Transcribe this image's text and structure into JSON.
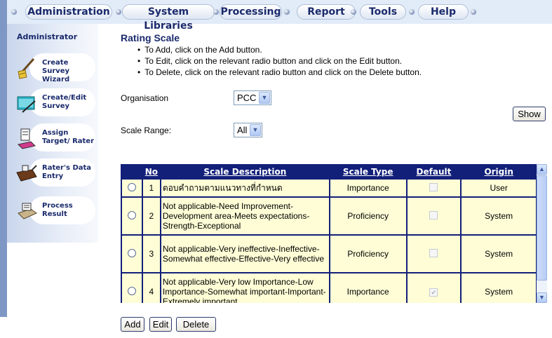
{
  "menu": {
    "tabs": [
      {
        "label": "Administration"
      },
      {
        "label": "System Libraries"
      },
      {
        "label": "Processing"
      },
      {
        "label": "Report"
      },
      {
        "label": "Tools"
      },
      {
        "label": "Help"
      }
    ]
  },
  "sidebar": {
    "title": "Administrator",
    "items": [
      {
        "label": "Create Survey Wizard",
        "icon": "wizard-broom-icon"
      },
      {
        "label": "Create/Edit Survey",
        "icon": "folder-edit-icon"
      },
      {
        "label": "Assign Target/ Rater",
        "icon": "assign-target-icon"
      },
      {
        "label": "Rater's Data Entry",
        "icon": "data-entry-icon"
      },
      {
        "label": "Process Result",
        "icon": "process-result-icon"
      }
    ]
  },
  "main": {
    "title": "Rating Scale",
    "instructions": [
      "To Add, click on the Add button.",
      "To Edit, click on the relevant radio button and click on the Edit button.",
      "To Delete, click on the relevant radio button and click on the Delete button."
    ],
    "organisation_label": "Organisation",
    "organisation_value": "PCC",
    "scale_range_label": "Scale Range:",
    "scale_range_value": "All",
    "show_button": "Show"
  },
  "table": {
    "headers": [
      "No",
      "Scale Description",
      "Scale Type",
      "Default",
      "Origin"
    ],
    "rows": [
      {
        "no": "1",
        "description": "ตอบคำถามตามแนวทางที่กำหนด",
        "type": "Importance",
        "default": false,
        "origin": "User"
      },
      {
        "no": "2",
        "description": "Not applicable-Need Improvement-Development area-Meets expectations-Strength-Exceptional",
        "type": "Proficiency",
        "default": false,
        "origin": "System"
      },
      {
        "no": "3",
        "description": "Not applicable-Very ineffective-Ineffective-Somewhat effective-Effective-Very effective",
        "type": "Proficiency",
        "default": false,
        "origin": "System"
      },
      {
        "no": "4",
        "description": "Not applicable-Very low Importance-Low Importance-Somewhat important-Important-Extremely important",
        "type": "Importance",
        "default": true,
        "origin": "System"
      }
    ]
  },
  "actions": {
    "add": "Add",
    "edit": "Edit",
    "delete": "Delete"
  }
}
